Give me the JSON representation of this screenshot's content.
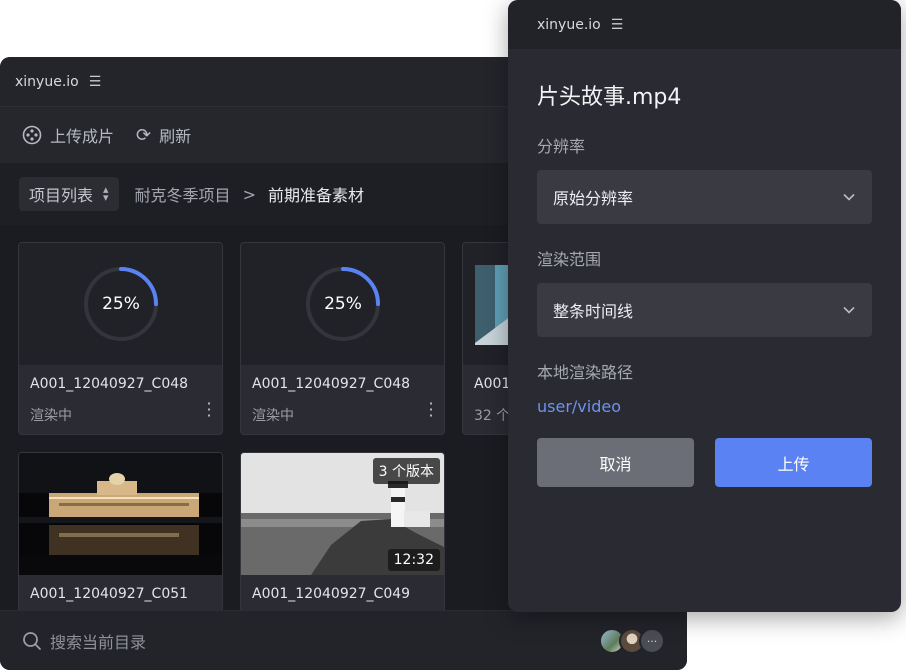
{
  "colors": {
    "accent": "#5a82f2",
    "ring_track": "#33353c",
    "link": "#6e92f0"
  },
  "back_window": {
    "title": "xinyue.io",
    "toolbar": {
      "upload_label": "上传成片",
      "refresh_label": "刷新"
    },
    "breadcrumb": {
      "select_label": "项目列表",
      "project": "耐克冬季项目",
      "separator": ">",
      "current": "前期准备素材"
    },
    "cards": [
      {
        "name": "A001_12040927_C048",
        "status": "渲染中",
        "progress_label": "25%",
        "progress": 0.25
      },
      {
        "name": "A001_12040927_C048",
        "status": "渲染中",
        "progress_label": "25%",
        "progress": 0.25
      },
      {
        "name": "A001",
        "status": "32 个"
      },
      {
        "name": "A001_12040927_C051"
      },
      {
        "name": "A001_12040927_C049",
        "versions_badge": "3 个版本",
        "duration_badge": "12:32"
      }
    ],
    "search": {
      "placeholder": "搜索当前目录",
      "more_label": "···"
    }
  },
  "dialog": {
    "title": "xinyue.io",
    "file_name": "片头故事.mp4",
    "resolution_label": "分辨率",
    "resolution_value": "原始分辨率",
    "range_label": "渲染范围",
    "range_value": "整条时间线",
    "path_label": "本地渲染路径",
    "path_value": "user/video",
    "cancel_label": "取消",
    "upload_label": "上传"
  }
}
